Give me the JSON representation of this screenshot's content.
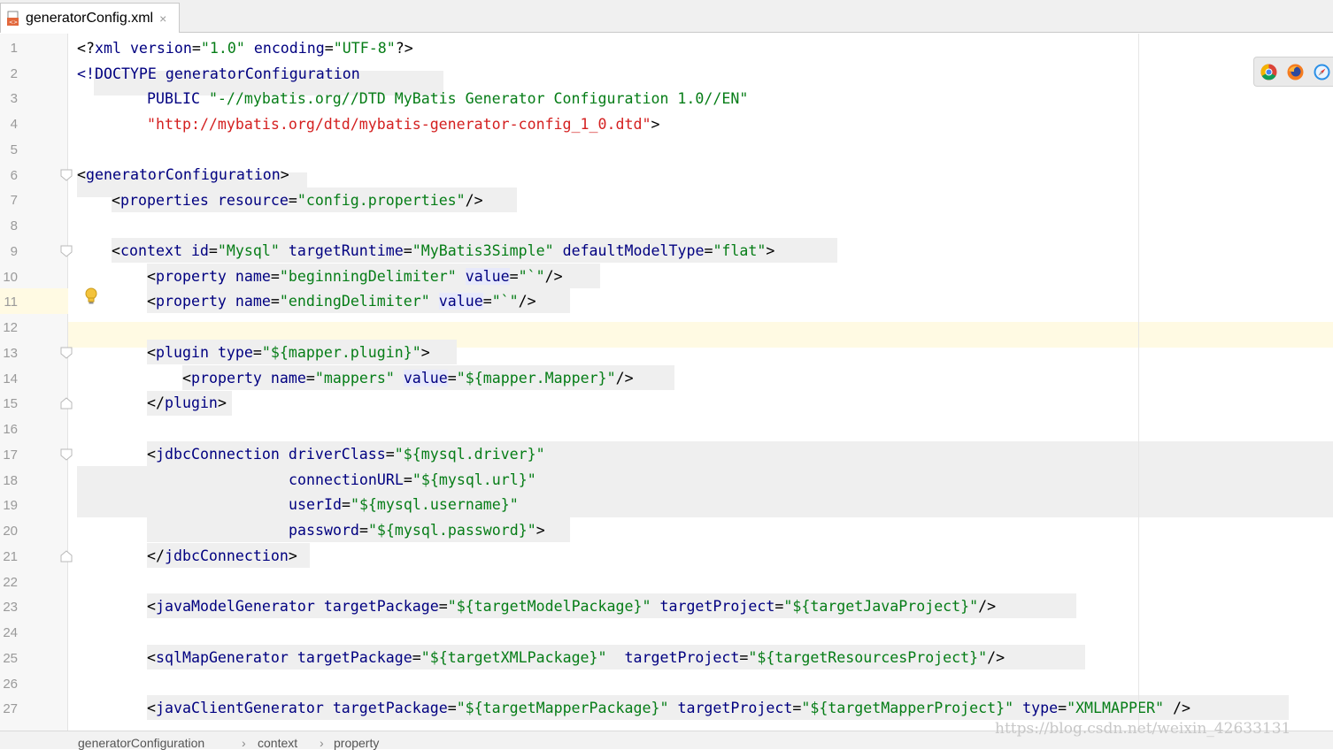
{
  "tab": {
    "filename": "generatorConfig.xml",
    "close_glyph": "×",
    "icon": "xml-file-icon"
  },
  "lines": {
    "n1": "1",
    "n2": "2",
    "n3": "3",
    "n4": "4",
    "n5": "5",
    "n6": "6",
    "n7": "7",
    "n8": "8",
    "n9": "9",
    "n10": "10",
    "n11": "11",
    "n12": "12",
    "n13": "13",
    "n14": "14",
    "n15": "15",
    "n16": "16",
    "n17": "17",
    "n18": "18",
    "n19": "19",
    "n20": "20",
    "n21": "21",
    "n22": "22",
    "n23": "23",
    "n24": "24",
    "n25": "25",
    "n26": "26",
    "n27": "27"
  },
  "code": {
    "l1": {
      "a": "<?",
      "b": "xml version",
      "c": "=",
      "d": "\"1.0\"",
      "e": " encoding",
      "f": "=",
      "g": "\"UTF-8\"",
      "h": "?>"
    },
    "l2": {
      "a": "<!DOCTYPE ",
      "b": "generatorConfiguration"
    },
    "l3": {
      "a": "PUBLIC ",
      "b": "\"-//mybatis.org//DTD MyBatis Generator Configuration 1.0//EN\""
    },
    "l4": {
      "a": "\"http://mybatis.org/dtd/mybatis-generator-config_1_0.dtd\"",
      "b": ">"
    },
    "l6": {
      "a": "<",
      "b": "generatorConfiguration",
      "c": ">"
    },
    "l7": {
      "a": "<",
      "b": "properties ",
      "c": "resource",
      "d": "=",
      "e": "\"config.properties\"",
      "f": "/>"
    },
    "l9": {
      "a": "<",
      "b": "context ",
      "c": "id",
      "d": "=",
      "e": "\"Mysql\"",
      "f": " targetRuntime",
      "g": "=",
      "h": "\"MyBatis3Simple\"",
      "i": " defaultModelType",
      "j": "=",
      "k": "\"flat\"",
      "l": ">"
    },
    "l10": {
      "a": "<",
      "b": "property ",
      "c": "name",
      "d": "=",
      "e": "\"beginningDelimiter\"",
      "f": " ",
      "g": "value",
      "h": "=",
      "i": "\"`\"",
      "j": "/>"
    },
    "l11": {
      "a": "<",
      "b": "property ",
      "c": "name",
      "d": "=",
      "e": "\"endingDelimiter\"",
      "f": " ",
      "g": "value",
      "h": "=",
      "i": "\"`\"",
      "j": "/>"
    },
    "l13": {
      "a": "<",
      "b": "plugin ",
      "c": "type",
      "d": "=",
      "e": "\"${mapper.plugin}\"",
      "f": ">"
    },
    "l14": {
      "a": "<",
      "b": "property ",
      "c": "name",
      "d": "=",
      "e": "\"mappers\"",
      "f": " ",
      "g": "value",
      "h": "=",
      "i": "\"${mapper.Mapper}\"",
      "j": "/>"
    },
    "l15": {
      "a": "</",
      "b": "plugin",
      "c": ">"
    },
    "l17": {
      "a": "<",
      "b": "jdbcConnection ",
      "c": "driverClass",
      "d": "=",
      "e": "\"${mysql.driver}\""
    },
    "l18": {
      "a": "connectionURL",
      "b": "=",
      "c": "\"${mysql.url}\""
    },
    "l19": {
      "a": "userId",
      "b": "=",
      "c": "\"${mysql.username}\""
    },
    "l20": {
      "a": "password",
      "b": "=",
      "c": "\"${mysql.password}\"",
      "d": ">"
    },
    "l21": {
      "a": "</",
      "b": "jdbcConnection",
      "c": ">"
    },
    "l23": {
      "a": "<",
      "b": "javaModelGenerator ",
      "c": "targetPackage",
      "d": "=",
      "e": "\"${targetModelPackage}\"",
      "f": " targetProject",
      "g": "=",
      "h": "\"${targetJavaProject}\"",
      "i": "/>"
    },
    "l25": {
      "a": "<",
      "b": "sqlMapGenerator ",
      "c": "targetPackage",
      "d": "=",
      "e": "\"${targetXMLPackage}\"",
      "f": "  targetProject",
      "g": "=",
      "h": "\"${targetResourcesProject}\"",
      "i": "/>"
    },
    "l27": {
      "a": "<",
      "b": "javaClientGenerator ",
      "c": "targetPackage",
      "d": "=",
      "e": "\"${targetMapperPackage}\"",
      "f": " targetProject",
      "g": "=",
      "h": "\"${targetMapperProject}\"",
      "i": " type",
      "j": "=",
      "k": "\"XMLMAPPER\"",
      "l": " />"
    }
  },
  "breadcrumb": {
    "c1": "generatorConfiguration",
    "c2": "context",
    "c3": "property",
    "sep": "›"
  },
  "watermark": "https://blog.csdn.net/weixin_42633131",
  "browsers": [
    "chrome-icon",
    "firefox-icon",
    "safari-icon"
  ],
  "colors": {
    "tag": "#000080",
    "string": "#067d17",
    "url": "#d42020",
    "current_line": "#fffae3"
  }
}
